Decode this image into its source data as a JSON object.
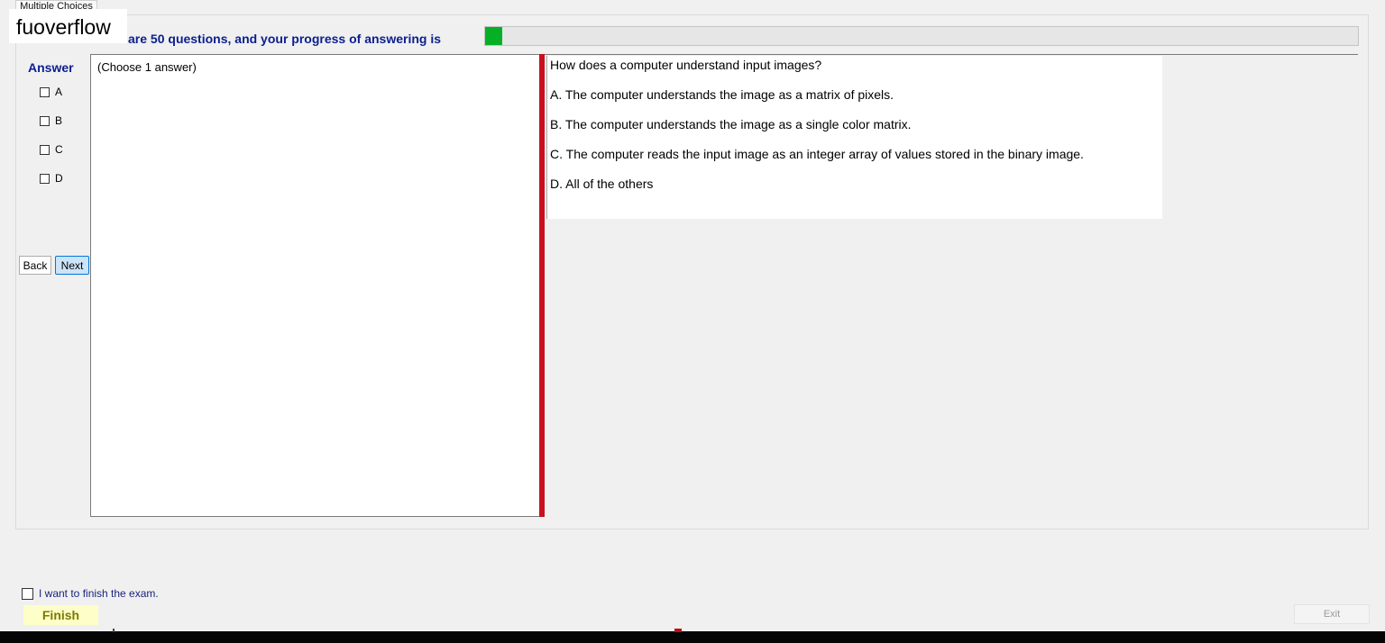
{
  "tab": {
    "label": "Multiple Choices"
  },
  "watermark": {
    "text": "fuoverflow"
  },
  "progress": {
    "text": "There are 50 questions, and your progress of answering is",
    "fraction": 0.02,
    "fill_color": "#06b025"
  },
  "answer_panel": {
    "title": "Answer",
    "options": [
      {
        "label": "A",
        "checked": false
      },
      {
        "label": "B",
        "checked": false
      },
      {
        "label": "C",
        "checked": false
      },
      {
        "label": "D",
        "checked": false
      }
    ]
  },
  "nav": {
    "back_label": "Back",
    "next_label": "Next"
  },
  "answer_box": {
    "hint": "(Choose 1 answer)"
  },
  "question": {
    "text": "How does a computer understand input images?",
    "choices": [
      "A.  The computer understands the image as a matrix of pixels.",
      "B.  The computer understands the image as a single color matrix.",
      "C.  The computer reads the input image as an integer array of values stored in the binary image.",
      "D.  All of the others"
    ]
  },
  "footer": {
    "finish_checkbox_label": "I want to finish the exam.",
    "finish_label": "Finish",
    "exit_label": "Exit"
  },
  "colors": {
    "heading": "#0a1f8f",
    "splitter": "#c8101e",
    "finish_bg": "#fefec8"
  }
}
